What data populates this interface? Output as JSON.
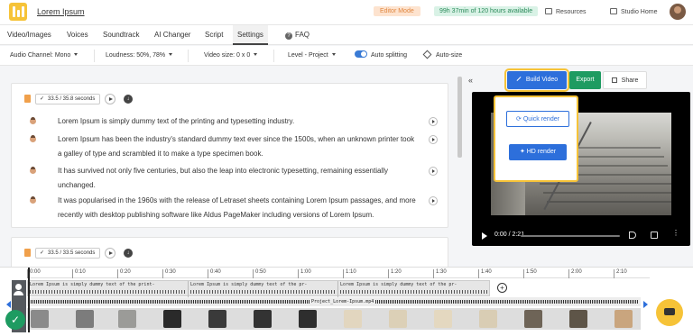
{
  "app": {
    "project_title": "Lorem Ipsum",
    "mode_badge": "Editor Mode",
    "time_available": "99h 37min of 120 hours available",
    "resources_label": "Resources",
    "studio_home_label": "Studio Home"
  },
  "tabs": [
    {
      "label": "Video/Images"
    },
    {
      "label": "Voices"
    },
    {
      "label": "Soundtrack"
    },
    {
      "label": "AI Changer"
    },
    {
      "label": "Script"
    },
    {
      "label": "Settings"
    },
    {
      "label": "FAQ"
    }
  ],
  "toolbar": {
    "audio_channel": "Audio Channel: Mono",
    "loudness": "Loudness: 50%, 78%",
    "video_size": "Video size: 0 x 0",
    "level": "Level - Project",
    "auto_splitting": "Auto splitting",
    "auto_size": "Auto-size"
  },
  "script": {
    "cards": [
      {
        "duration": "33.5 / 35.8 seconds",
        "lines": [
          "Lorem Ipsum is simply dummy text of the printing and typesetting industry.",
          "Lorem Ipsum has been the industry's standard dummy text ever since the 1500s, when an unknown printer took a galley of type and scrambled it to make a type specimen book.",
          "It has survived not only five centuries, but also the leap into electronic typesetting, remaining essentially unchanged.",
          "It was popularised in the 1960s with the release of Letraset sheets containing Lorem Ipsum passages, and more recently with desktop publishing software like Aldus PageMaker including versions of Lorem Ipsum."
        ]
      },
      {
        "duration": "33.5 / 33.5 seconds",
        "lines": []
      }
    ]
  },
  "preview": {
    "build_video": "Build Video",
    "export": "Export",
    "share": "Share",
    "quick_render": "Quick render",
    "hd_render": "HD render",
    "time": "0:00 / 2:21"
  },
  "timeline": {
    "ticks": [
      "0:00",
      "0:10",
      "0:20",
      "0:30",
      "0:40",
      "0:50",
      "1:00",
      "1:10",
      "1:20",
      "1:30",
      "1:40",
      "1:50",
      "2:00",
      "2:10"
    ],
    "audio_segments": [
      "Lorem Ipsum is simply dummy text of the print-",
      "Lorem Ipsum is simply dummy text of the pr-",
      "Lorem Ipsum is simply dummy text of the pr-"
    ],
    "music_file": "Project_Lorem-Ipsum.mp4"
  }
}
